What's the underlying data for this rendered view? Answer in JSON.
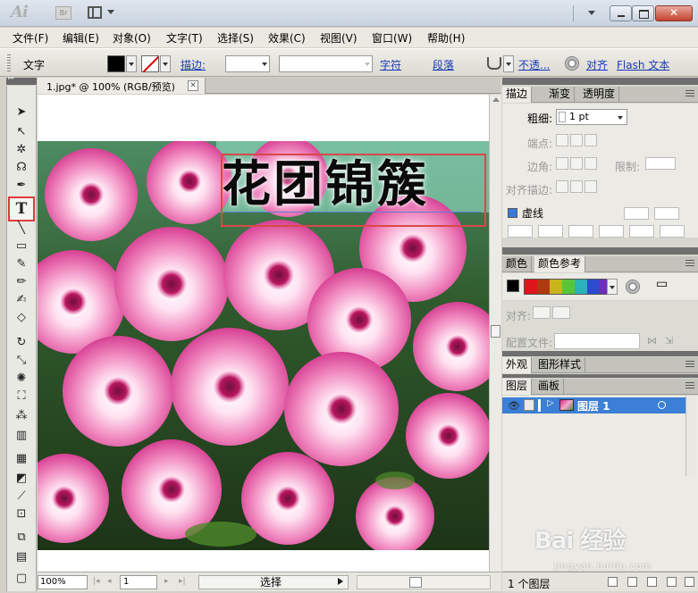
{
  "app": {
    "logo": "Ai",
    "bridge_label": "Br",
    "close_glyph": "✕"
  },
  "menu": [
    {
      "label": "文件(F)"
    },
    {
      "label": "编辑(E)"
    },
    {
      "label": "对象(O)"
    },
    {
      "label": "文字(T)"
    },
    {
      "label": "选择(S)"
    },
    {
      "label": "效果(C)"
    },
    {
      "label": "视图(V)"
    },
    {
      "label": "窗口(W)"
    },
    {
      "label": "帮助(H)"
    }
  ],
  "control": {
    "tool_label": "文字",
    "stroke_label": "描边:",
    "char_link": "字符",
    "para_link": "段落",
    "opacity_link": "不透...",
    "align_link": "对齐",
    "flash_link": "Flash 文本"
  },
  "document": {
    "tab_label": "1.jpg* @ 100% (RGB/预览)",
    "tab_close": "✕",
    "title_text": "花团锦簇"
  },
  "toolbox": {
    "type_tool": "T"
  },
  "status": {
    "zoom": "100%",
    "page": "1",
    "mode": "选择",
    "first": "|◂",
    "prev": "◂",
    "next": "▸",
    "last": "▸|"
  },
  "panels": {
    "stroke": {
      "tabs": [
        "描边",
        "渐变",
        "透明度"
      ],
      "weight_label": "粗细:",
      "weight_value": "1 pt",
      "cap_label": "端点:",
      "corner_label": "边角:",
      "limit_label": "限制:",
      "align_label": "对齐描边:",
      "dash_label": "虚线"
    },
    "color": {
      "tabs": [
        "颜色",
        "颜色参考"
      ],
      "harmony_colors": [
        "#e0141b",
        "#b03a10",
        "#c8b51b",
        "#58c63a",
        "#2bb3b8",
        "#2d4bd0",
        "#6e2fb8"
      ]
    },
    "align": {
      "align_label": "对齐:",
      "profile_label": "配置文件:"
    },
    "appearance": {
      "tabs": [
        "外观",
        "图形样式"
      ]
    },
    "layers": {
      "tabs": [
        "图层",
        "画板"
      ],
      "layer_name": "图层 1",
      "count_label": "1 个图层"
    }
  },
  "watermark": {
    "main": "Bai 经验",
    "sub": "jingyan.baidu.com"
  }
}
